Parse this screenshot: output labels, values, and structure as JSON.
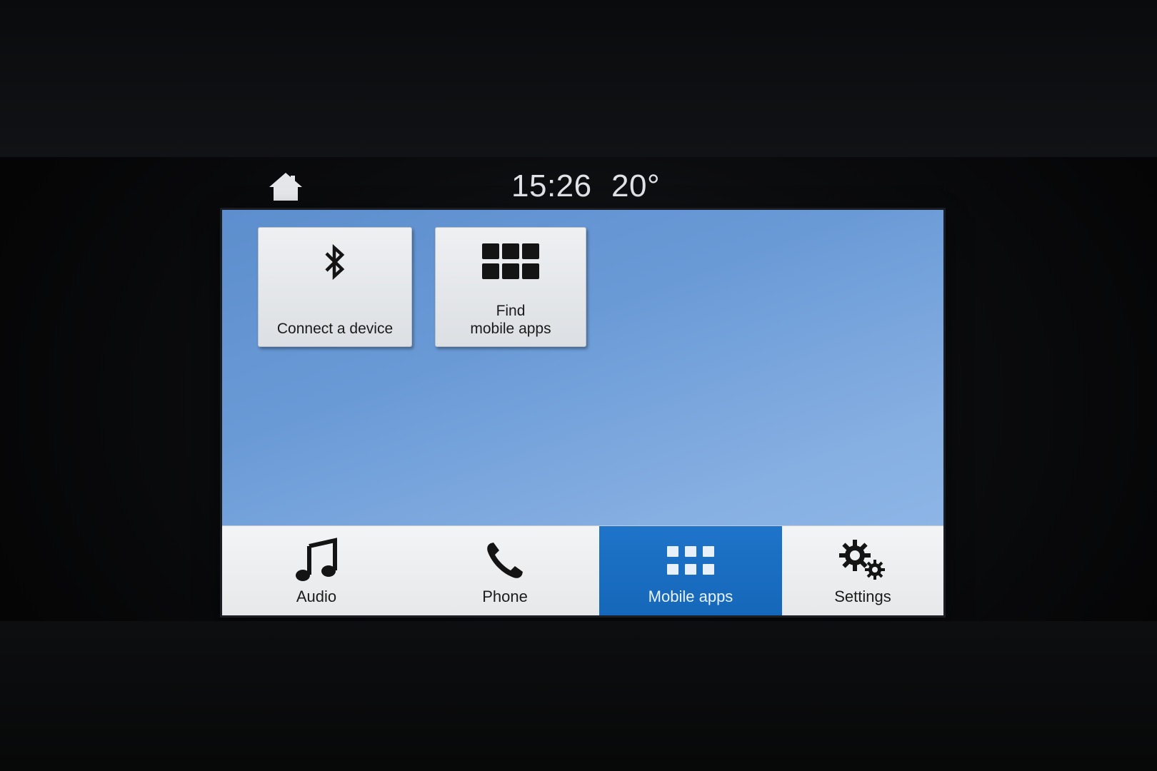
{
  "status": {
    "home_icon": "home-icon",
    "time": "15:26",
    "temperature": "20°"
  },
  "tiles": [
    {
      "label": "Connect a device",
      "icon": "bluetooth-icon"
    },
    {
      "label": "Find\nmobile apps",
      "icon": "app-grid-icon"
    }
  ],
  "nav": {
    "items": [
      {
        "label": "Audio",
        "icon": "music-note-icon",
        "active": false
      },
      {
        "label": "Phone",
        "icon": "phone-icon",
        "active": false
      },
      {
        "label": "Mobile apps",
        "icon": "app-grid-icon",
        "active": true
      },
      {
        "label": "Settings",
        "icon": "gears-icon",
        "active": false
      }
    ]
  },
  "colors": {
    "screen_background": "#6a9ad6",
    "active_tab": "#1f74c9",
    "nav_background": "#f3f4f5"
  }
}
